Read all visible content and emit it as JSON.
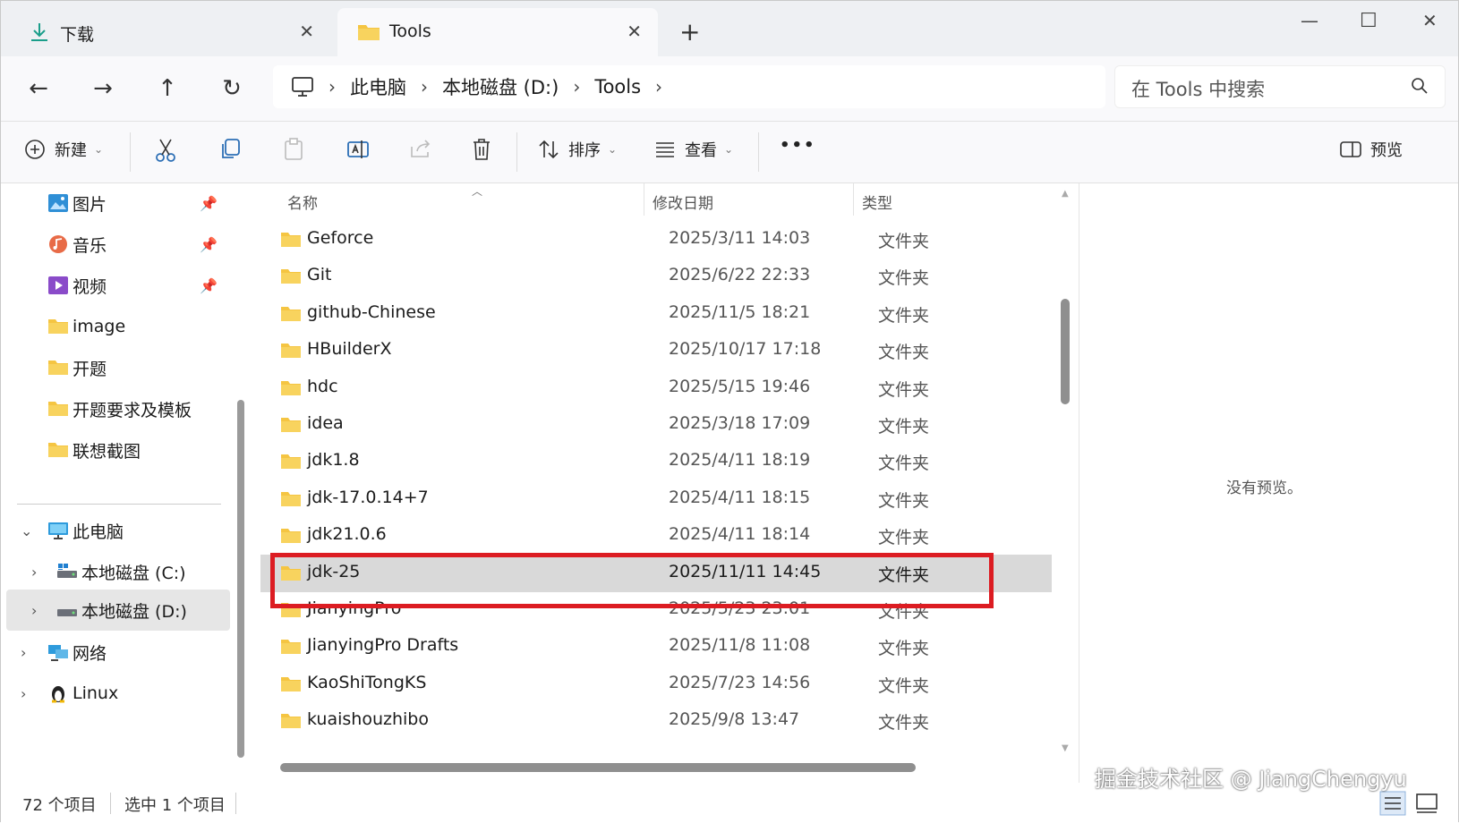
{
  "tabs": [
    {
      "label": "下载",
      "icon": "download-arrow-icon",
      "active": false
    },
    {
      "label": "Tools",
      "icon": "folder-icon",
      "active": true
    }
  ],
  "nav": {
    "breadcrumb": [
      "此电脑",
      "本地磁盘 (D:)",
      "Tools"
    ],
    "search_placeholder": "在 Tools 中搜索"
  },
  "commands": {
    "new_label": "新建",
    "sort_label": "排序",
    "view_label": "查看",
    "more_label": "•••",
    "preview_label": "预览"
  },
  "sidebar": {
    "quick": [
      {
        "label": "图片",
        "icon": "pictures-icon",
        "pinned": true
      },
      {
        "label": "音乐",
        "icon": "music-icon",
        "pinned": true
      },
      {
        "label": "视频",
        "icon": "video-icon",
        "pinned": true
      },
      {
        "label": "image",
        "icon": "folder-icon",
        "pinned": false
      },
      {
        "label": "开题",
        "icon": "folder-icon",
        "pinned": false
      },
      {
        "label": "开题要求及模板",
        "icon": "folder-icon",
        "pinned": false
      },
      {
        "label": "联想截图",
        "icon": "folder-icon",
        "pinned": false
      }
    ],
    "tree": [
      {
        "label": "此电脑",
        "icon": "computer-icon"
      },
      {
        "label": "本地磁盘 (C:)",
        "icon": "drive-icon"
      },
      {
        "label": "本地磁盘 (D:)",
        "icon": "drive-icon"
      },
      {
        "label": "网络",
        "icon": "network-icon"
      },
      {
        "label": "Linux",
        "icon": "linux-penguin-icon"
      }
    ]
  },
  "filelist": {
    "columns": {
      "name": "名称",
      "date": "修改日期",
      "type": "类型"
    },
    "rows": [
      {
        "name": "Geforce",
        "date": "2025/3/11 14:03",
        "type": "文件夹"
      },
      {
        "name": "Git",
        "date": "2025/6/22 22:33",
        "type": "文件夹"
      },
      {
        "name": "github-Chinese",
        "date": "2025/11/5 18:21",
        "type": "文件夹"
      },
      {
        "name": "HBuilderX",
        "date": "2025/10/17 17:18",
        "type": "文件夹"
      },
      {
        "name": "hdc",
        "date": "2025/5/15 19:46",
        "type": "文件夹"
      },
      {
        "name": "idea",
        "date": "2025/3/18 17:09",
        "type": "文件夹"
      },
      {
        "name": "jdk1.8",
        "date": "2025/4/11 18:19",
        "type": "文件夹"
      },
      {
        "name": "jdk-17.0.14+7",
        "date": "2025/4/11 18:15",
        "type": "文件夹"
      },
      {
        "name": "jdk21.0.6",
        "date": "2025/4/11 18:14",
        "type": "文件夹"
      },
      {
        "name": "jdk-25",
        "date": "2025/11/11 14:45",
        "type": "文件夹"
      },
      {
        "name": "JianyingPro",
        "date": "2025/5/23 23:01",
        "type": "文件夹"
      },
      {
        "name": "JianyingPro Drafts",
        "date": "2025/11/8 11:08",
        "type": "文件夹"
      },
      {
        "name": "KaoShiTongKS",
        "date": "2025/7/23 14:56",
        "type": "文件夹"
      },
      {
        "name": "kuaishouzhibo",
        "date": "2025/9/8 13:47",
        "type": "文件夹"
      }
    ],
    "selected_name": "jdk-25"
  },
  "preview": {
    "message": "没有预览。"
  },
  "status": {
    "item_count": "72 个项目",
    "selected_count": "选中 1 个项目"
  },
  "watermark": "掘金技术社区 @ JiangChengyu",
  "colors": {
    "highlight": "#dc1c22",
    "folder": "#f5c542",
    "accent": "#0067c0"
  }
}
